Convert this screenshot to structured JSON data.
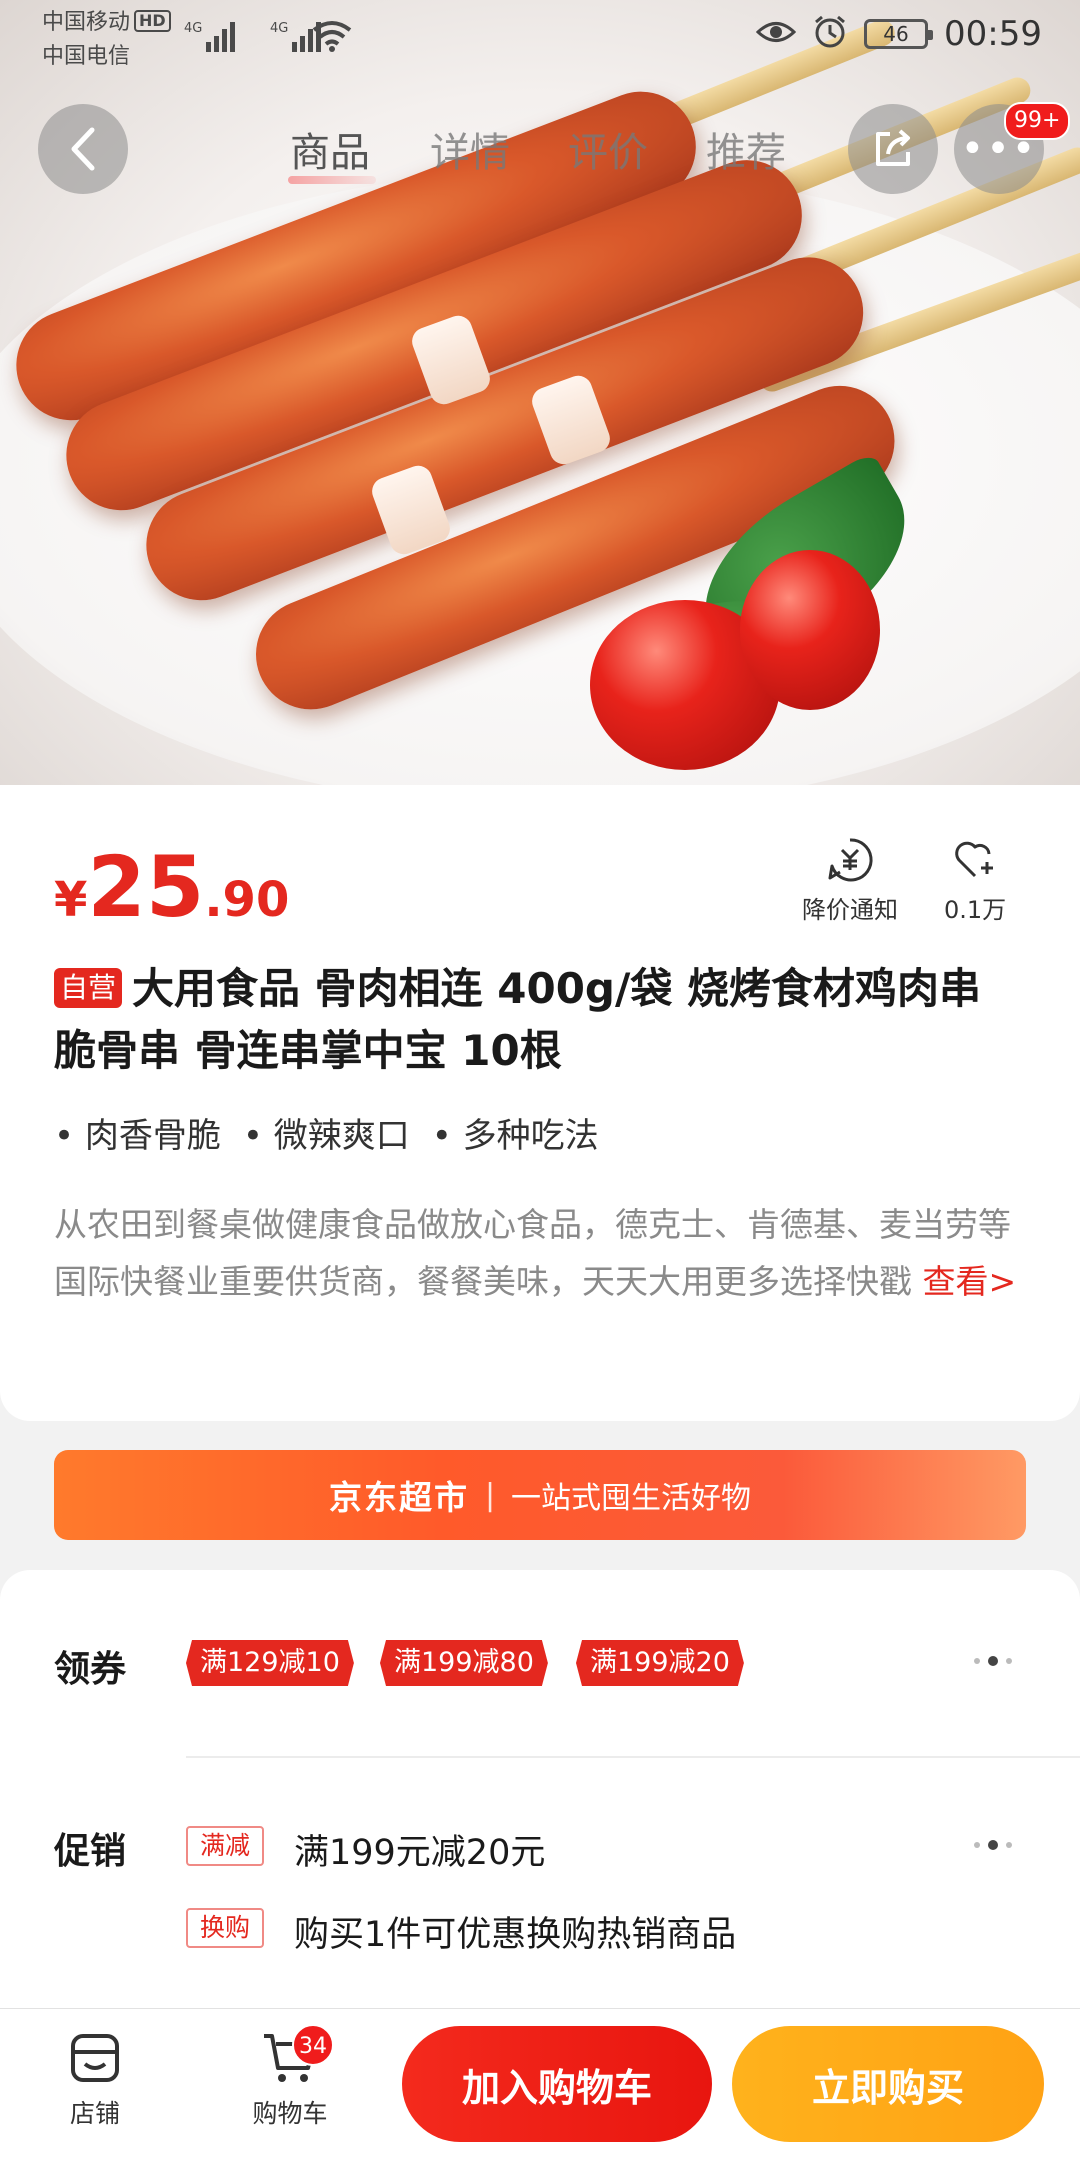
{
  "status_bar": {
    "carrier1": "中国移动",
    "hd_badge": "HD",
    "carrier2": "中国电信",
    "signal1_label": "4G",
    "signal2_label": "4G",
    "battery": "46",
    "time": "00:59"
  },
  "nav": {
    "tabs": [
      {
        "label": "商品",
        "active": true
      },
      {
        "label": "详情",
        "active": false
      },
      {
        "label": "评价",
        "active": false
      },
      {
        "label": "推荐",
        "active": false
      }
    ],
    "more_badge": "99+"
  },
  "product": {
    "price": {
      "symbol": "¥",
      "integer": "25",
      "decimal": ".90"
    },
    "price_alert_label": "降价通知",
    "favorite_count": "0.1万",
    "self_operated_badge": "自营",
    "title": "大用食品 骨肉相连 400g/袋 烧烤食材鸡肉串 脆骨串 骨连串掌中宝 10根",
    "tags": [
      "肉香骨脆",
      "微辣爽口",
      "多种吃法"
    ],
    "description": "从农田到餐桌做健康食品做放心食品，德克士、肯德基、麦当劳等国际快餐业重要供货商，餐餐美味，天天大用更多选择快戳",
    "description_more": "查看>"
  },
  "jd_banner": {
    "name": "京东超市",
    "separator": "|",
    "slogan": "一站式囤生活好物"
  },
  "coupons": {
    "label": "领券",
    "items": [
      "满129减10",
      "满199减80",
      "满199减20"
    ]
  },
  "promotions": {
    "label": "促销",
    "items": [
      {
        "tag": "满减",
        "text": "满199元减20元"
      },
      {
        "tag": "换购",
        "text": "购买1件可优惠换购热销商品"
      }
    ]
  },
  "bottom_bar": {
    "store_label": "店铺",
    "cart_label": "购物车",
    "cart_count": "34",
    "add_to_cart": "加入购物车",
    "buy_now": "立即购买"
  },
  "colors": {
    "accent_red": "#e4281f",
    "buy_orange": "#ffa214",
    "banner_orange": "#ff5a2a"
  }
}
